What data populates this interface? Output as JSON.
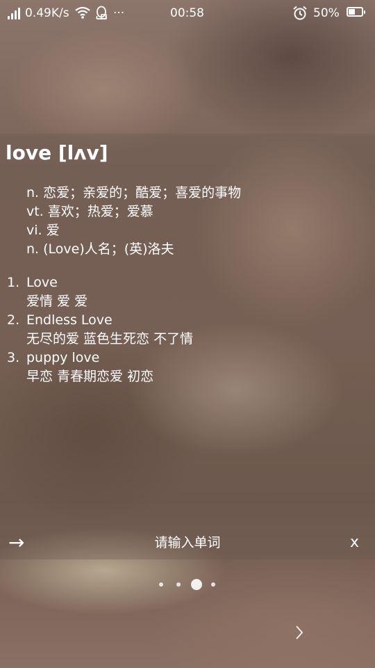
{
  "status_bar": {
    "network_speed": "0.49K/s",
    "more": "···",
    "time": "00:58",
    "battery_percent": "50%",
    "battery_level": 0.5,
    "icons": [
      "signal-icon",
      "wifi-icon",
      "qq-icon",
      "alarm-icon",
      "battery-icon"
    ]
  },
  "entry": {
    "word": "love",
    "phonetic": "[lʌv]",
    "definitions": [
      "n. 恋爱；亲爱的；酷爱；喜爱的事物",
      "vt. 喜欢；热爱；爱慕",
      "vi. 爱",
      "n. (Love)人名；(英)洛夫"
    ],
    "phrases": [
      {
        "num": "1.",
        "phrase": "Love",
        "translation": "爱情 爱 爱"
      },
      {
        "num": "2.",
        "phrase": "Endless Love",
        "translation": "无尽的爱 蓝色生死恋 不了情"
      },
      {
        "num": "3.",
        "phrase": "puppy love",
        "translation": "早恋 青春期恋爱 初恋"
      }
    ]
  },
  "input_bar": {
    "arrow": "→",
    "placeholder": "请输入单词",
    "value": "",
    "clear": "x"
  },
  "pager": {
    "pages": 4,
    "current": 3
  },
  "icons": {
    "next": "chevron-right-icon"
  }
}
